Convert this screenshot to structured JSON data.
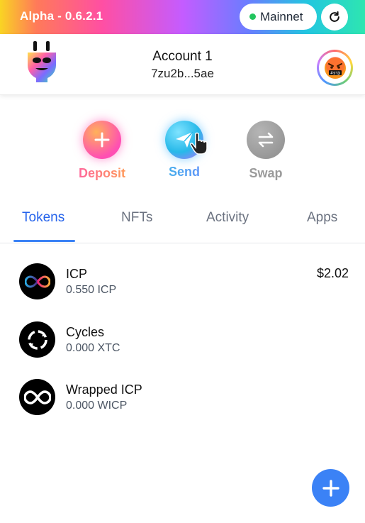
{
  "topbar": {
    "version": "Alpha - 0.6.2.1",
    "network_label": "Mainnet",
    "network_status_color": "#22c55e"
  },
  "header": {
    "account_name": "Account 1",
    "account_address": "7zu2b...5ae",
    "logo_icon": "plug-logo-icon",
    "avatar_icon": "cursing-face-emoji"
  },
  "actions": [
    {
      "label": "Deposit",
      "icon": "plus-icon"
    },
    {
      "label": "Send",
      "icon": "paper-plane-icon"
    },
    {
      "label": "Swap",
      "icon": "swap-arrows-icon"
    }
  ],
  "tabs": [
    {
      "label": "Tokens",
      "active": true
    },
    {
      "label": "NFTs",
      "active": false
    },
    {
      "label": "Activity",
      "active": false
    },
    {
      "label": "Apps",
      "active": false
    }
  ],
  "tokens": [
    {
      "name": "ICP",
      "amount": "0.550 ICP",
      "value": "$2.02",
      "icon": "icp-infinity-icon"
    },
    {
      "name": "Cycles",
      "amount": "0.000 XTC",
      "value": "",
      "icon": "cycles-icon"
    },
    {
      "name": "Wrapped ICP",
      "amount": "0.000 WICP",
      "value": "",
      "icon": "wicp-infinity-icon"
    }
  ],
  "colors": {
    "accent": "#3b82f6",
    "deposit": "#ff5fa8",
    "send": "#39b8e6",
    "swap": "#9a9a9a"
  }
}
